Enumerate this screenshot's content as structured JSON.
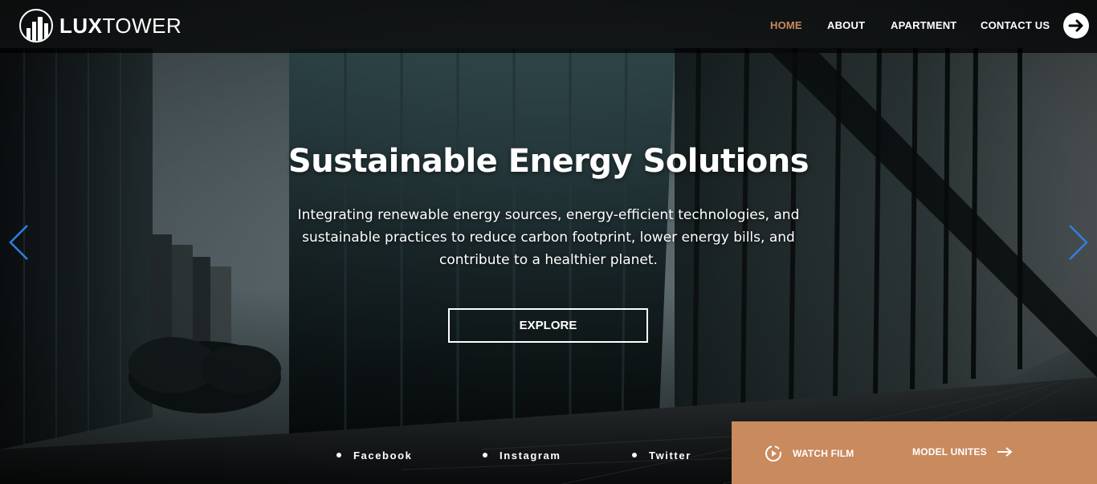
{
  "brand": {
    "name_bold": "LUX",
    "name_light": "TOWER"
  },
  "nav": {
    "items": [
      {
        "label": "HOME",
        "active": true
      },
      {
        "label": "ABOUT",
        "active": false
      },
      {
        "label": "APARTMENT",
        "active": false
      },
      {
        "label": "CONTACT US",
        "active": false
      }
    ],
    "login_icon": "arrow-right-circle-icon"
  },
  "hero": {
    "title": "Sustainable Energy Solutions",
    "subtitle_lines": [
      "Integrating renewable energy sources, energy-efficient technologies, and",
      "sustainable practices to reduce carbon footprint, lower energy bills, and",
      "contribute to a healthier planet."
    ],
    "cta_label": "EXPLORE",
    "prev_icon": "chevron-left-icon",
    "next_icon": "chevron-right-icon"
  },
  "social": [
    {
      "label": "Facebook"
    },
    {
      "label": "Instagram"
    },
    {
      "label": "Twitter"
    }
  ],
  "actions": {
    "watch_film_label": "WATCH FILM",
    "watch_film_icon": "play-circle-icon",
    "model_units_label": "MODEL UNITES",
    "model_units_icon": "arrow-right-icon"
  },
  "colors": {
    "accent": "#c98a5e",
    "arrow": "#2f7fe0",
    "header_bg": "#000000"
  }
}
